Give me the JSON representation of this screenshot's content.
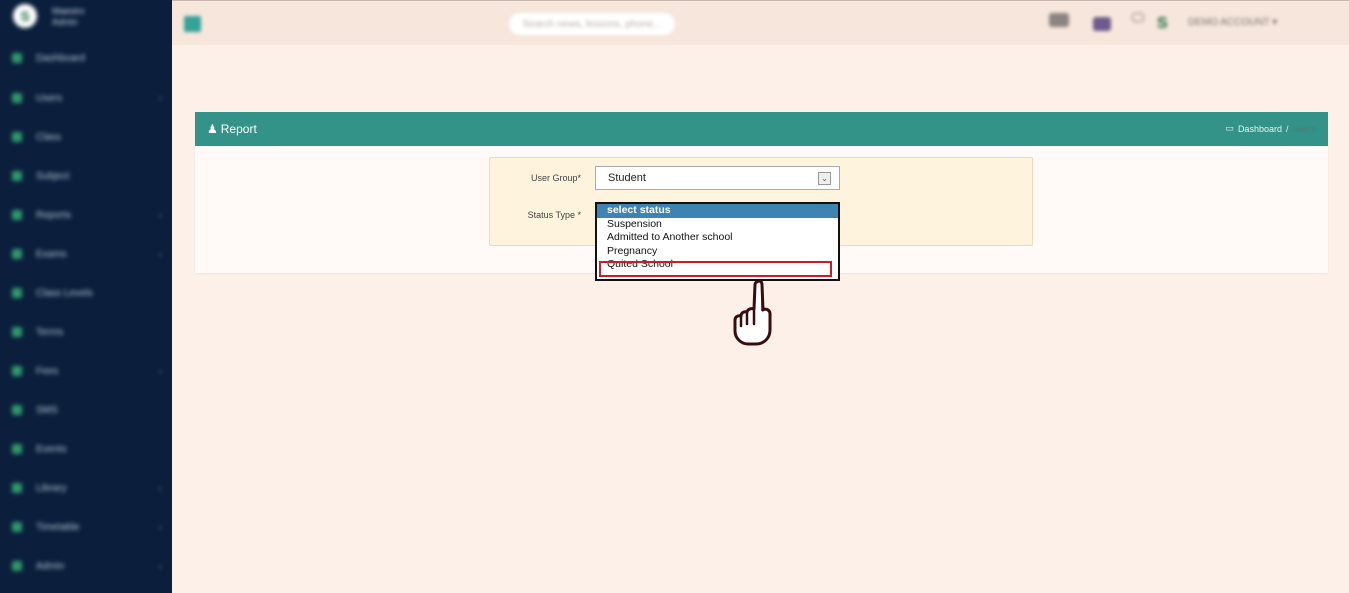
{
  "sidebar": {
    "brand_line1": "Maestro",
    "brand_line2": "Admin",
    "items": [
      {
        "label": "Dashboard",
        "has_arrow": false
      },
      {
        "label": "Users",
        "has_arrow": true
      },
      {
        "label": "Class",
        "has_arrow": false
      },
      {
        "label": "Subject",
        "has_arrow": false
      },
      {
        "label": "Reports",
        "has_arrow": true
      },
      {
        "label": "Exams",
        "has_arrow": true
      },
      {
        "label": "Class Levels",
        "has_arrow": false
      },
      {
        "label": "Terms",
        "has_arrow": false
      },
      {
        "label": "Fees",
        "has_arrow": true
      },
      {
        "label": "SMS",
        "has_arrow": false
      },
      {
        "label": "Events",
        "has_arrow": false
      },
      {
        "label": "Library",
        "has_arrow": true
      },
      {
        "label": "Timetable",
        "has_arrow": true
      },
      {
        "label": "Admin",
        "has_arrow": true
      }
    ]
  },
  "topbar": {
    "search_placeholder": "Search news, lessons, phone...",
    "account_label": "DEMO ACCOUNT",
    "account_caret": "▾"
  },
  "panel": {
    "title": "Report",
    "breadcrumb": {
      "home": "Dashboard",
      "separator": "/",
      "current": "Users"
    }
  },
  "form": {
    "user_group_label": "User Group*",
    "user_group_value": "Student",
    "status_type_label": "Status Type *"
  },
  "status_options": [
    "select status",
    "Suspension",
    "Admitted to Another school",
    "Pregnancy",
    "Quited School"
  ],
  "colors": {
    "header_teal": "#339388",
    "sidebar_navy": "#0b1f3d",
    "selected_option": "#3d84b4",
    "highlight_red": "#cc1d22"
  }
}
